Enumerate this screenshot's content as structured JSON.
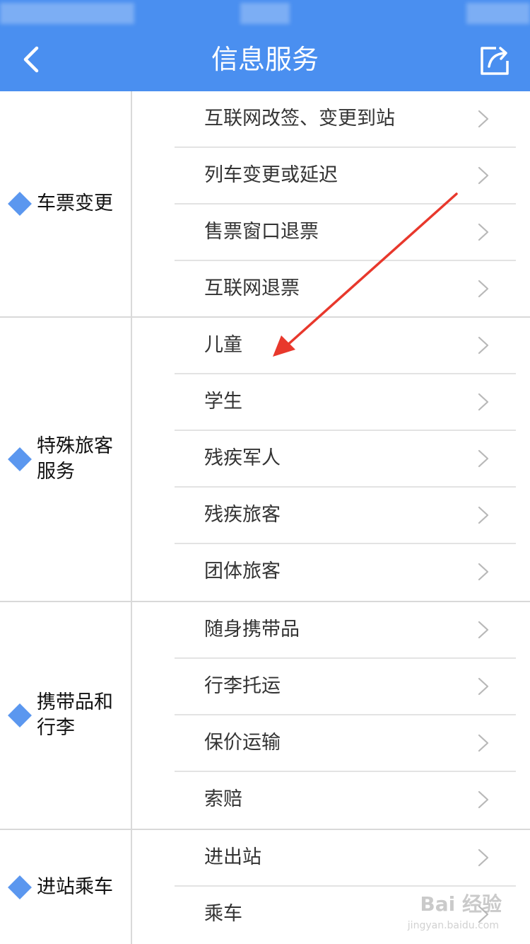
{
  "nav": {
    "title": "信息服务",
    "back_icon": "chevron-left-icon",
    "share_icon": "share-icon"
  },
  "colors": {
    "accent": "#4a8ff0",
    "diamond": "#5b97ef",
    "annotation_arrow": "#e8382c"
  },
  "groups": [
    {
      "label": "车票变更",
      "items": [
        "互联网改签、变更到站",
        "列车变更或延迟",
        "售票窗口退票",
        "互联网退票"
      ]
    },
    {
      "label": "特殊旅客服务",
      "items": [
        "儿童",
        "学生",
        "残疾军人",
        "残疾旅客",
        "团体旅客"
      ]
    },
    {
      "label": "携带品和行李",
      "items": [
        "随身携带品",
        "行李托运",
        "保价运输",
        "索赔"
      ]
    },
    {
      "label": "进站乘车",
      "items": [
        "进出站",
        "乘车"
      ]
    }
  ],
  "watermark": {
    "text": "Bai 经验",
    "sub": "jingyan.baidu.com"
  }
}
